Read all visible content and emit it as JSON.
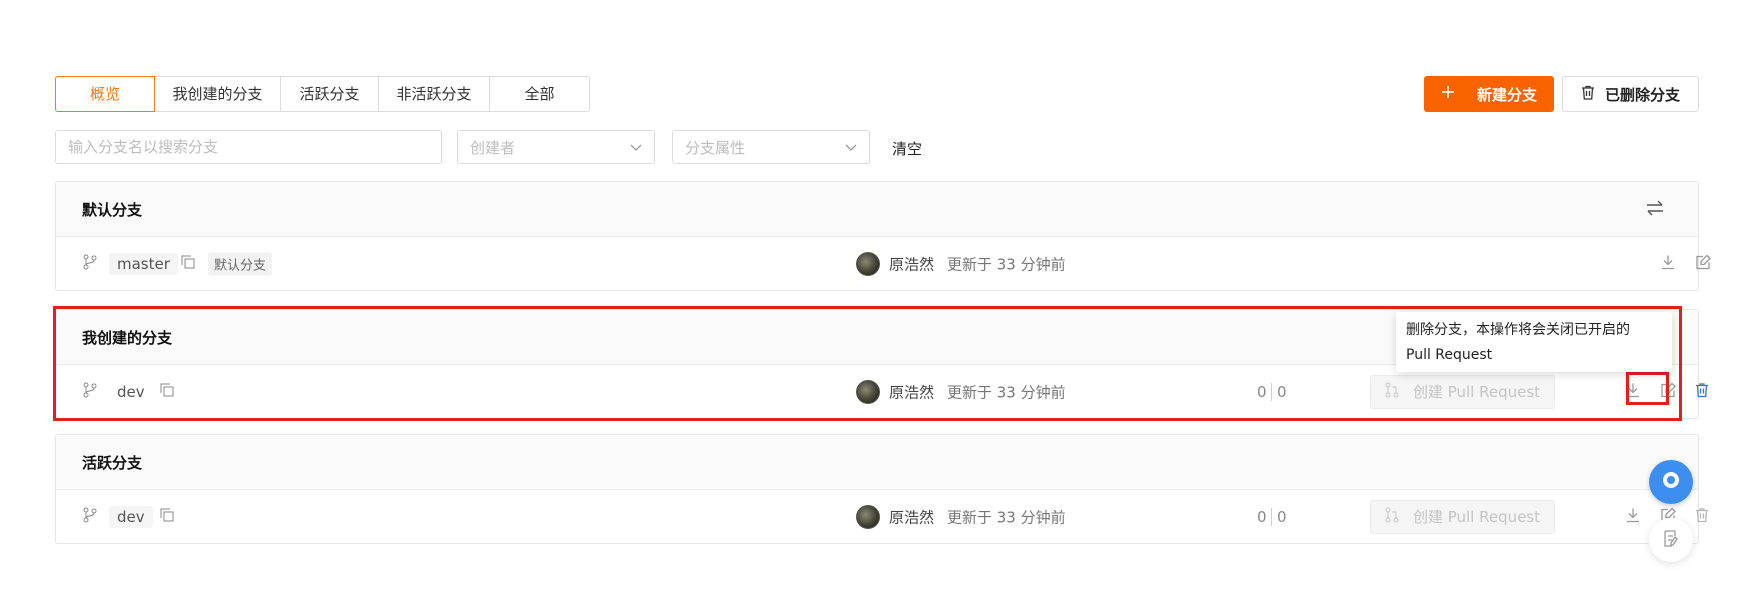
{
  "tabs": [
    {
      "label": "概览"
    },
    {
      "label": "我创建的分支"
    },
    {
      "label": "活跃分支"
    },
    {
      "label": "非活跃分支"
    },
    {
      "label": "全部"
    }
  ],
  "actions": {
    "new_branch": "新建分支",
    "deleted_branches": "已删除分支"
  },
  "filters": {
    "search_placeholder": "输入分支名以搜索分支",
    "creator_placeholder": "创建者",
    "attribute_placeholder": "分支属性",
    "clear_label": "清空"
  },
  "sections": {
    "default": {
      "title": "默认分支",
      "row": {
        "branch": "master",
        "badge": "默认分支",
        "author": "原浩然",
        "updated": "更新于 33 分钟前"
      }
    },
    "mine": {
      "title": "我创建的分支",
      "row": {
        "branch": "dev",
        "author": "原浩然",
        "updated": "更新于 33 分钟前",
        "ahead": "0",
        "behind": "0",
        "pr_label": "创建 Pull Request"
      }
    },
    "active": {
      "title": "活跃分支",
      "row": {
        "branch": "dev",
        "author": "原浩然",
        "updated": "更新于 33 分钟前",
        "ahead": "0",
        "behind": "0",
        "pr_label": "创建 Pull Request"
      }
    }
  },
  "tooltip": {
    "line1": "删除分支，本操作将会关闭已开启的",
    "line2": "Pull Request"
  },
  "colors": {
    "accent": "#fa6400",
    "tab_active": "#f47a20",
    "highlight": "#e02020",
    "link_blue": "#3b6fd8"
  },
  "icons": [
    "plus-icon",
    "trash-icon",
    "chevron-down-icon",
    "swap-icon",
    "git-branch-icon",
    "copy-icon",
    "download-icon",
    "edit-icon",
    "pull-request-icon",
    "chat-icon",
    "note-icon"
  ]
}
